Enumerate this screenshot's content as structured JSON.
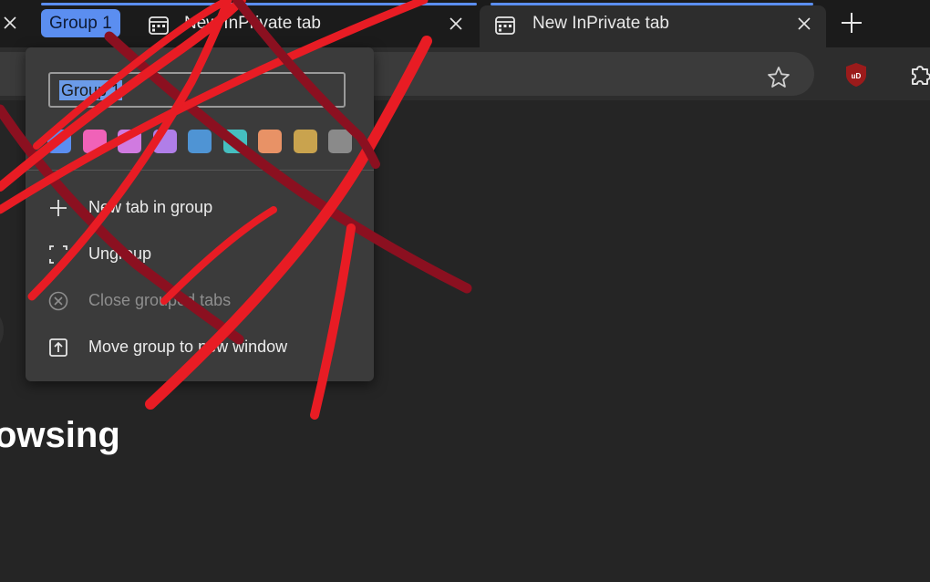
{
  "tabs": {
    "group_chip_label": "Group 1",
    "inactive_tab_title": "New InPrivate tab",
    "active_tab_title": "New InPrivate tab",
    "group_color": "#5b8ef0"
  },
  "toolbar": {
    "favorite_icon": "star-outline-icon",
    "extension_1_icon": "ublock-origin-icon",
    "extension_2_icon": "puzzle-icon"
  },
  "group_menu": {
    "name_field_value": "Group 1",
    "colors": [
      "#5b8ef0",
      "#f062b8",
      "#d07ae0",
      "#b07ee8",
      "#4f94d4",
      "#45bfc0",
      "#e89266",
      "#c9a34e",
      "#8a8a8a"
    ],
    "items": [
      {
        "label": "New tab in group",
        "icon": "plus-icon",
        "enabled": true
      },
      {
        "label": "Ungroup",
        "icon": "ungroup-icon",
        "enabled": true
      },
      {
        "label": "Close grouped tabs",
        "icon": "close-circle-icon",
        "enabled": false
      },
      {
        "label": "Move group to new window",
        "icon": "move-to-window-icon",
        "enabled": true
      }
    ]
  },
  "page": {
    "heading_fragment": "owsing"
  },
  "annotation": {
    "stroke_color_primary": "#e81c24",
    "stroke_color_secondary": "#8b1020"
  }
}
